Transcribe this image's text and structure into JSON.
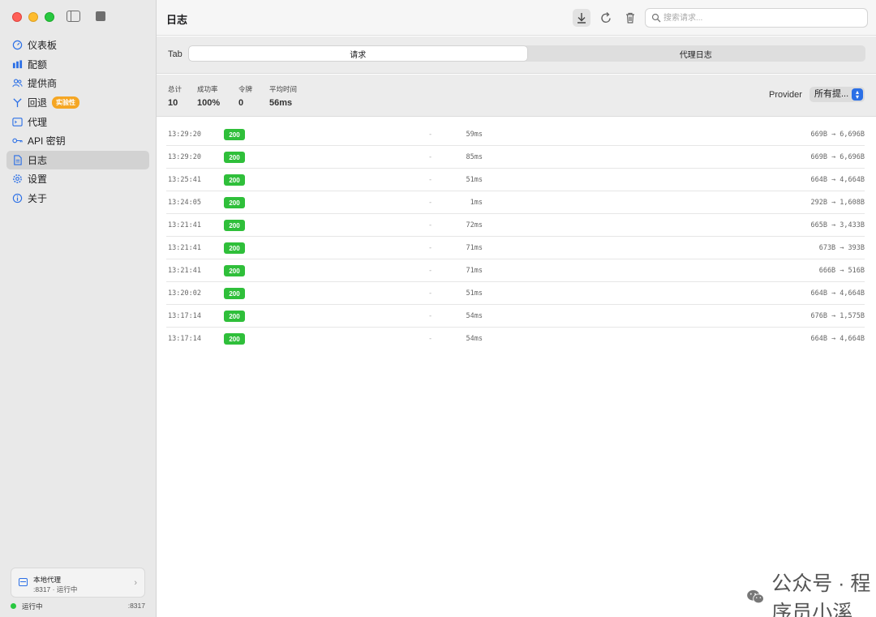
{
  "sidebar": {
    "items": [
      {
        "label": "仪表板",
        "icon": "gauge-icon"
      },
      {
        "label": "配额",
        "icon": "bar-chart-icon"
      },
      {
        "label": "提供商",
        "icon": "users-icon"
      },
      {
        "label": "回退",
        "icon": "fork-icon",
        "badge": "实验性"
      },
      {
        "label": "代理",
        "icon": "terminal-icon"
      },
      {
        "label": "API 密钥",
        "icon": "key-icon"
      },
      {
        "label": "日志",
        "icon": "document-icon"
      },
      {
        "label": "设置",
        "icon": "gear-icon"
      },
      {
        "label": "关于",
        "icon": "info-icon"
      }
    ],
    "active_index": 6,
    "proxy_card": {
      "title": "本地代理",
      "subtitle": ":8317 · 运行中"
    },
    "status": {
      "text": "运行中",
      "port": ":8317"
    }
  },
  "toolbar": {
    "title": "日志",
    "search_placeholder": "搜索请求..."
  },
  "tabs": {
    "label": "Tab",
    "options": [
      "请求",
      "代理日志"
    ],
    "active": 0
  },
  "stats": {
    "items": [
      {
        "label": "总计",
        "value": "10"
      },
      {
        "label": "成功率",
        "value": "100%"
      },
      {
        "label": "令牌",
        "value": "0"
      },
      {
        "label": "平均时间",
        "value": "56ms"
      }
    ],
    "provider_label": "Provider",
    "provider_value": "所有提..."
  },
  "logs": [
    {
      "time": "13:29:20",
      "status": "200",
      "dash": "-",
      "latency": "59ms",
      "size": "669B → 6,696B"
    },
    {
      "time": "13:29:20",
      "status": "200",
      "dash": "-",
      "latency": "85ms",
      "size": "669B → 6,696B"
    },
    {
      "time": "13:25:41",
      "status": "200",
      "dash": "-",
      "latency": "51ms",
      "size": "664B → 4,664B"
    },
    {
      "time": "13:24:05",
      "status": "200",
      "dash": "-",
      "latency": "1ms",
      "size": "292B → 1,608B"
    },
    {
      "time": "13:21:41",
      "status": "200",
      "dash": "-",
      "latency": "72ms",
      "size": "665B → 3,433B"
    },
    {
      "time": "13:21:41",
      "status": "200",
      "dash": "-",
      "latency": "71ms",
      "size": "673B → 393B"
    },
    {
      "time": "13:21:41",
      "status": "200",
      "dash": "-",
      "latency": "71ms",
      "size": "666B → 516B"
    },
    {
      "time": "13:20:02",
      "status": "200",
      "dash": "-",
      "latency": "51ms",
      "size": "664B → 4,664B"
    },
    {
      "time": "13:17:14",
      "status": "200",
      "dash": "-",
      "latency": "54ms",
      "size": "676B → 1,575B"
    },
    {
      "time": "13:17:14",
      "status": "200",
      "dash": "-",
      "latency": "54ms",
      "size": "664B → 4,664B"
    }
  ],
  "watermark": {
    "text": "公众号 · 程序员小溪"
  },
  "colors": {
    "accent": "#2b6fe6",
    "success": "#2fbf3a",
    "badge": "#f5a623"
  }
}
